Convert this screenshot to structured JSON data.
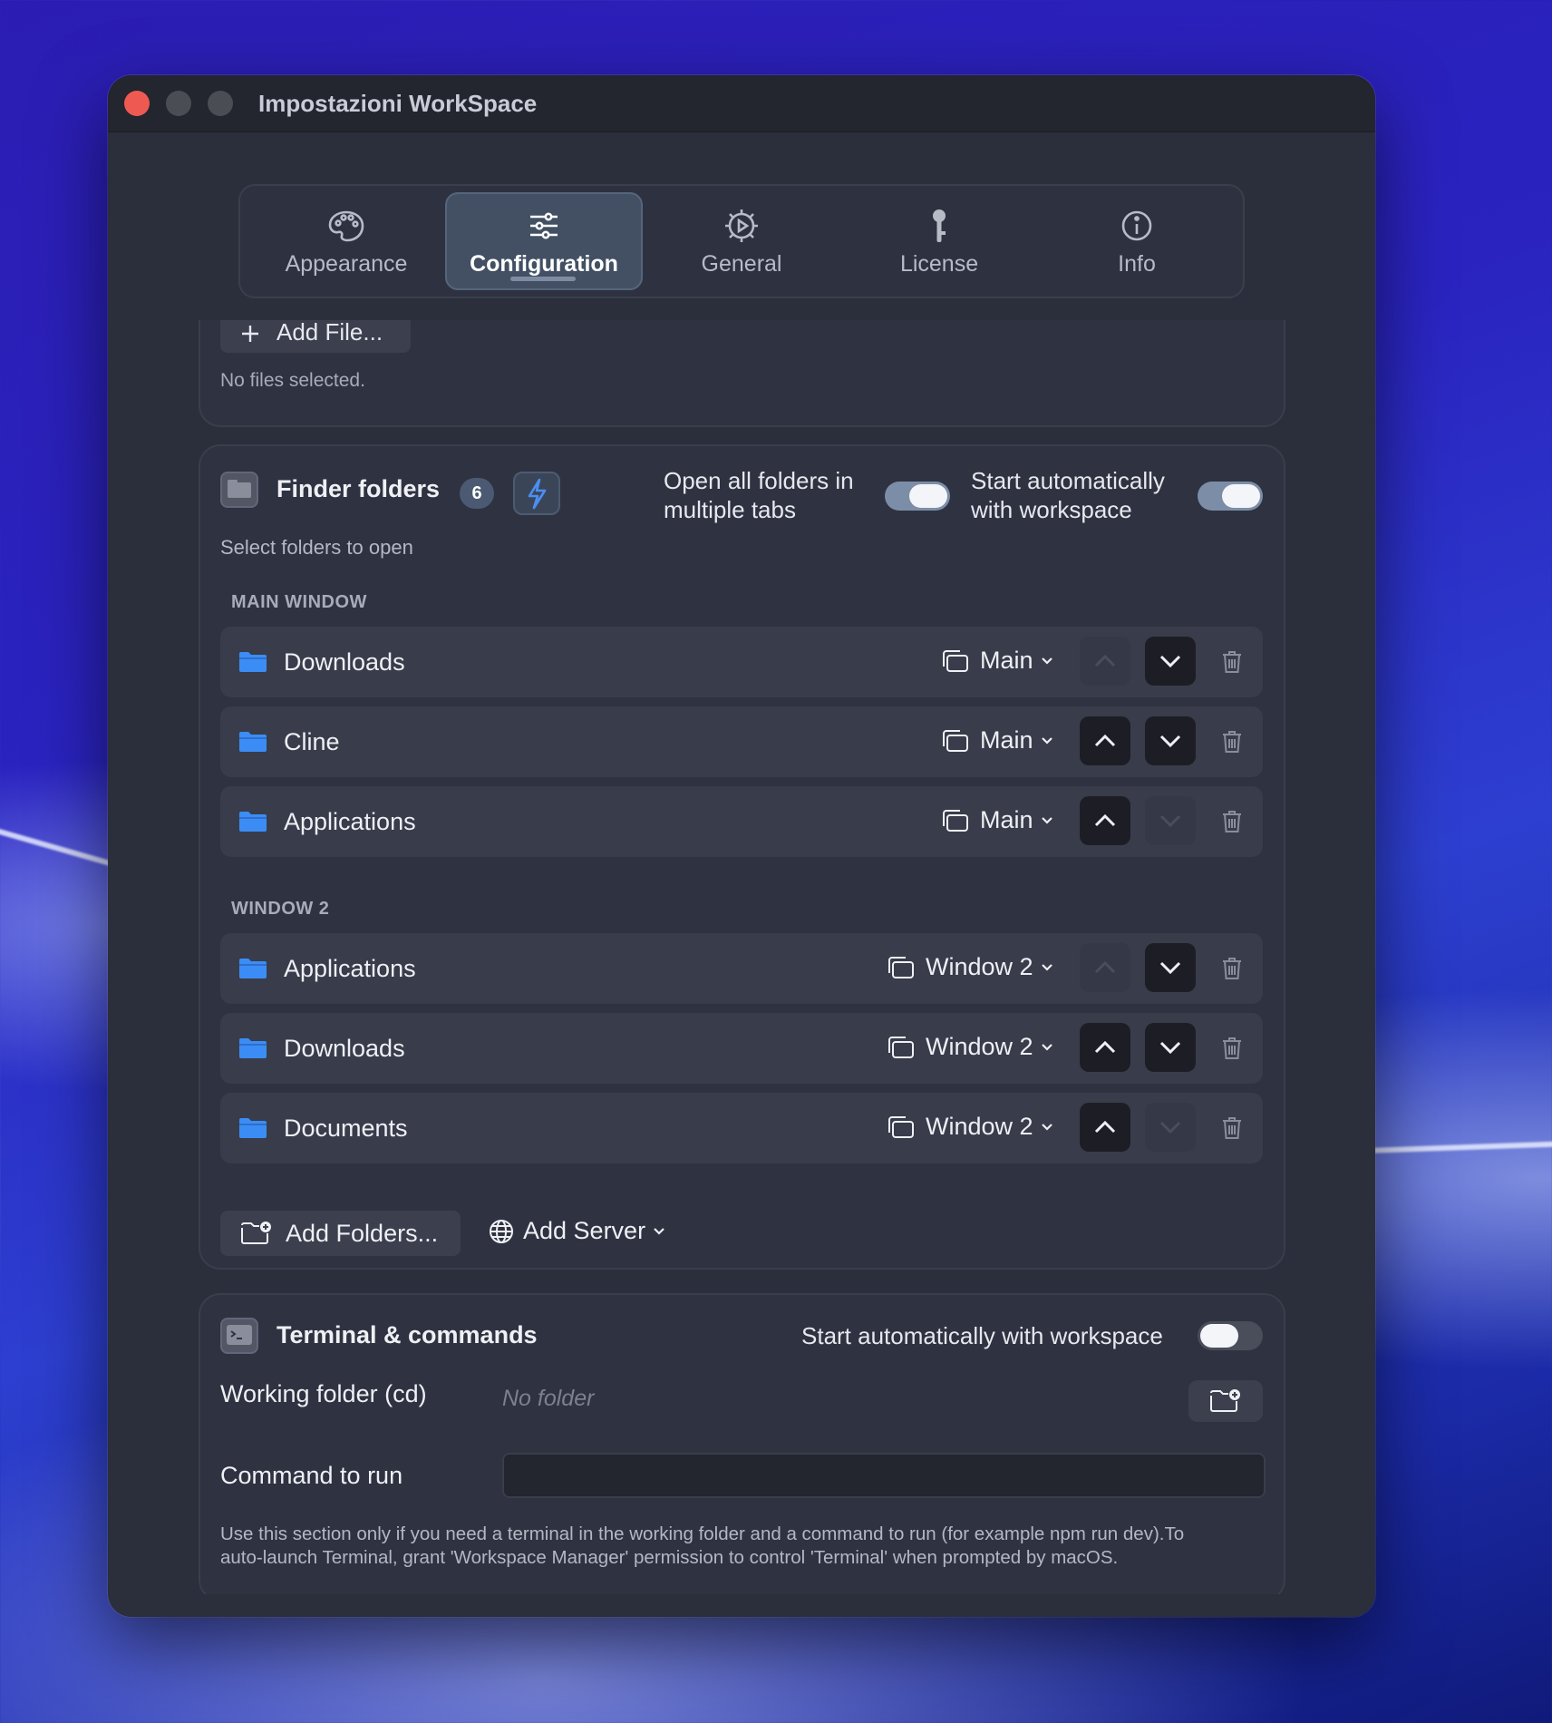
{
  "window": {
    "title": "Impostazioni WorkSpace"
  },
  "tabs": [
    {
      "label": "Appearance",
      "icon": "palette-icon",
      "active": false
    },
    {
      "label": "Configuration",
      "icon": "sliders-icon",
      "active": true
    },
    {
      "label": "General",
      "icon": "gear-icon",
      "active": false
    },
    {
      "label": "License",
      "icon": "key-icon",
      "active": false
    },
    {
      "label": "Info",
      "icon": "info-icon",
      "active": false
    }
  ],
  "files": {
    "add_label": "Add File...",
    "status": "No files selected."
  },
  "finder": {
    "title": "Finder folders",
    "count": "6",
    "open_tabs_label_line1": "Open all folders in",
    "open_tabs_label_line2": "multiple tabs",
    "open_tabs_on": true,
    "auto_start_label_line1": "Start automatically",
    "auto_start_label_line2": "with workspace",
    "auto_start_on": true,
    "subtitle": "Select folders to open",
    "groups": [
      {
        "label": "MAIN WINDOW",
        "rows": [
          {
            "name": "Downloads",
            "window": "Main",
            "can_move_up": false,
            "can_move_down": true
          },
          {
            "name": "Cline",
            "window": "Main",
            "can_move_up": true,
            "can_move_down": true
          },
          {
            "name": "Applications",
            "window": "Main",
            "can_move_up": true,
            "can_move_down": false
          }
        ]
      },
      {
        "label": "WINDOW 2",
        "rows": [
          {
            "name": "Applications",
            "window": "Window 2",
            "can_move_up": false,
            "can_move_down": true
          },
          {
            "name": "Downloads",
            "window": "Window 2",
            "can_move_up": true,
            "can_move_down": true
          },
          {
            "name": "Documents",
            "window": "Window 2",
            "can_move_up": true,
            "can_move_down": false
          }
        ]
      }
    ],
    "add_folders_label": "Add Folders...",
    "add_server_label": "Add Server"
  },
  "terminal": {
    "title": "Terminal & commands",
    "auto_start_label": "Start automatically with workspace",
    "auto_start_on": false,
    "working_folder_label": "Working folder (cd)",
    "working_folder_placeholder": "No folder",
    "command_label": "Command to run",
    "command_value": "",
    "help_line1": "Use this section only if you need a terminal in the working folder and a command to run (for example npm run dev).To",
    "help_line2": "auto-launch Terminal, grant 'Workspace Manager' permission to control 'Terminal' when prompted by macOS."
  },
  "colors": {
    "accent_folder": "#3b8df5",
    "toggle_on": "#7c8ea7",
    "traffic_close": "#ee5a52"
  }
}
